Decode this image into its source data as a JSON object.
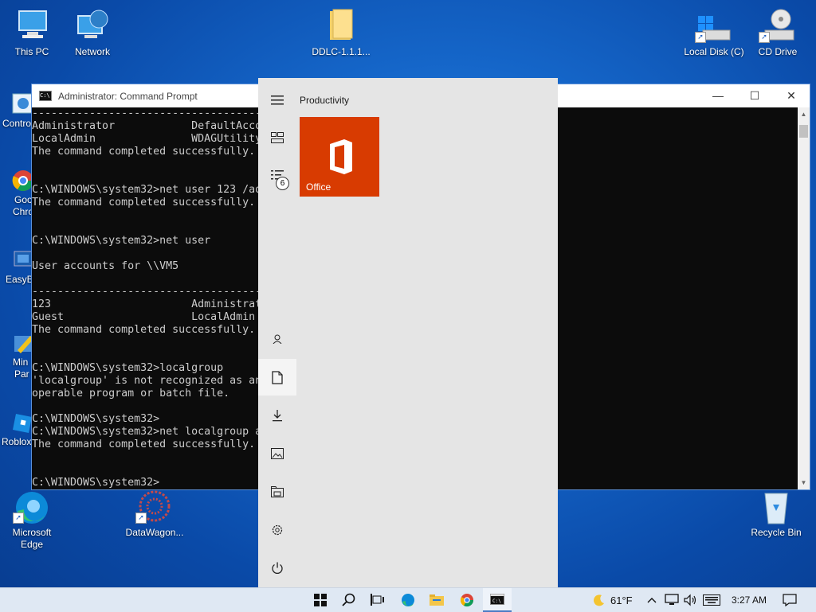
{
  "desktop": {
    "icons": {
      "this_pc": "This PC",
      "network": "Network",
      "ddlc": "DDLC-1.1.1...",
      "local_disk": "Local Disk (C)",
      "cd_drive": "CD Drive",
      "control": "Contro",
      "google_chrome_1": "Goo",
      "google_chrome_2": "Chro",
      "easybcd": "EasyB",
      "minitool_1": "Min",
      "minitool_2": "Par",
      "roblox": "Roblox",
      "edge_1": "Microsoft",
      "edge_2": "Edge",
      "datawagon": "DataWagon...",
      "recycle_bin": "Recycle Bin"
    }
  },
  "cmd": {
    "title": "Administrator: Command Prompt",
    "lines": [
      "-------------------------------------------------------------------------------",
      "Administrator            DefaultAccount           Guest",
      "LocalAdmin               WDAGUtilityAccount",
      "The command completed successfully.",
      "",
      "",
      "C:\\WINDOWS\\system32>net user 123 /add",
      "The command completed successfully.",
      "",
      "",
      "C:\\WINDOWS\\system32>net user",
      "",
      "User accounts for \\\\VM5",
      "",
      "-------------------------------------------------------------------------------",
      "123                      Administrator            DefaultAccount",
      "Guest                    LocalAdmin               WDAGUtilityAccount",
      "The command completed successfully.",
      "",
      "",
      "C:\\WINDOWS\\system32>localgroup",
      "'localgroup' is not recognized as an internal or external command,",
      "operable program or batch file.",
      "",
      "C:\\WINDOWS\\system32>",
      "C:\\WINDOWS\\system32>net localgroup administrators 123 /add",
      "The command completed successfully.",
      "",
      "",
      "C:\\WINDOWS\\system32>"
    ]
  },
  "start_menu": {
    "group_title": "Productivity",
    "tile_label": "Office",
    "badge_count": "6",
    "tile_color": "#d83b01"
  },
  "taskbar": {
    "temperature": "61°F",
    "time": "3:27 AM"
  }
}
